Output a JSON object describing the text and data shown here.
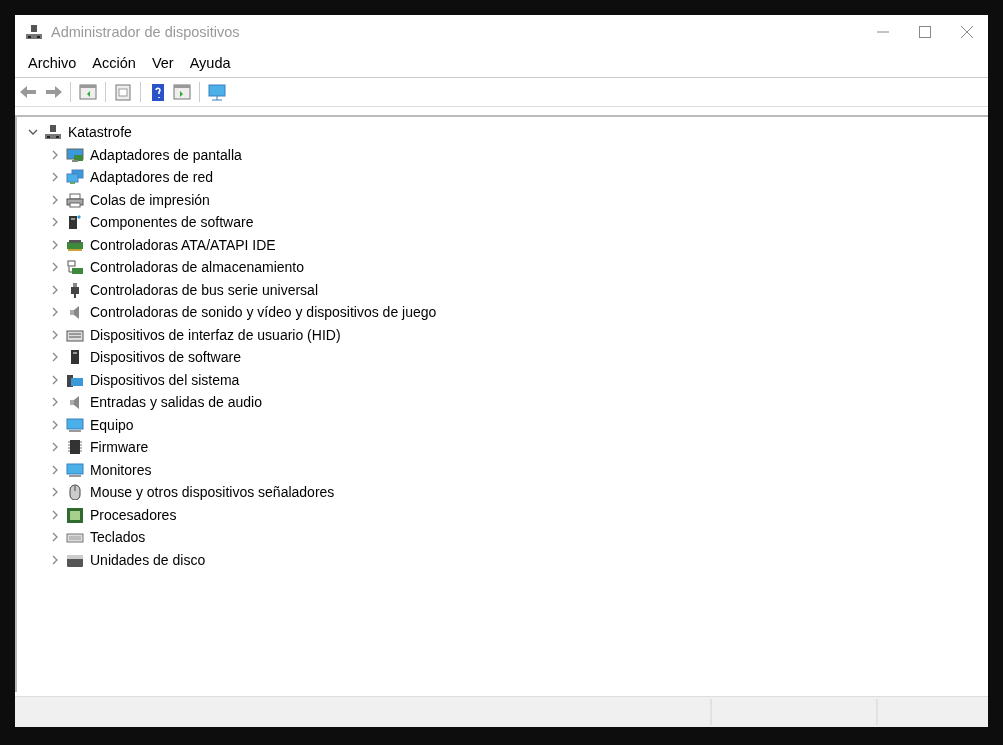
{
  "window": {
    "title": "Administrador de dispositivos"
  },
  "menu": [
    {
      "label": "Archivo"
    },
    {
      "label": "Acción"
    },
    {
      "label": "Ver"
    },
    {
      "label": "Ayuda"
    }
  ],
  "tree": {
    "label": "Katastrofe",
    "kind": "host",
    "expanded": true,
    "children": [
      {
        "label": "Adaptadores de pantalla",
        "kind": "display",
        "expanded": false
      },
      {
        "label": "Adaptadores de red",
        "kind": "network",
        "expanded": false
      },
      {
        "label": "Colas de impresión",
        "kind": "printer",
        "expanded": false
      },
      {
        "label": "Componentes de software",
        "kind": "component",
        "expanded": false
      },
      {
        "label": "Controladoras ATA/ATAPI IDE",
        "kind": "card",
        "expanded": false
      },
      {
        "label": "Controladoras de almacenamiento",
        "kind": "storage",
        "expanded": false
      },
      {
        "label": "Controladoras de bus serie universal",
        "kind": "usb",
        "expanded": false
      },
      {
        "label": "Controladoras de sonido y vídeo y dispositivos de juego",
        "kind": "speaker",
        "expanded": false
      },
      {
        "label": "Dispositivos de interfaz de usuario (HID)",
        "kind": "hid",
        "expanded": false
      },
      {
        "label": "Dispositivos de software",
        "kind": "tower",
        "expanded": false
      },
      {
        "label": "Dispositivos del sistema",
        "kind": "system",
        "expanded": false
      },
      {
        "label": "Entradas y salidas de audio",
        "kind": "speaker",
        "expanded": false
      },
      {
        "label": "Equipo",
        "kind": "monitor",
        "expanded": false
      },
      {
        "label": "Firmware",
        "kind": "chip",
        "expanded": false
      },
      {
        "label": "Monitores",
        "kind": "monitor",
        "expanded": false
      },
      {
        "label": "Mouse y otros dispositivos señaladores",
        "kind": "mouse",
        "expanded": false
      },
      {
        "label": "Procesadores",
        "kind": "processor",
        "expanded": false
      },
      {
        "label": "Teclados",
        "kind": "keyboard",
        "expanded": false
      },
      {
        "label": "Unidades de disco",
        "kind": "disk",
        "expanded": false
      }
    ]
  }
}
